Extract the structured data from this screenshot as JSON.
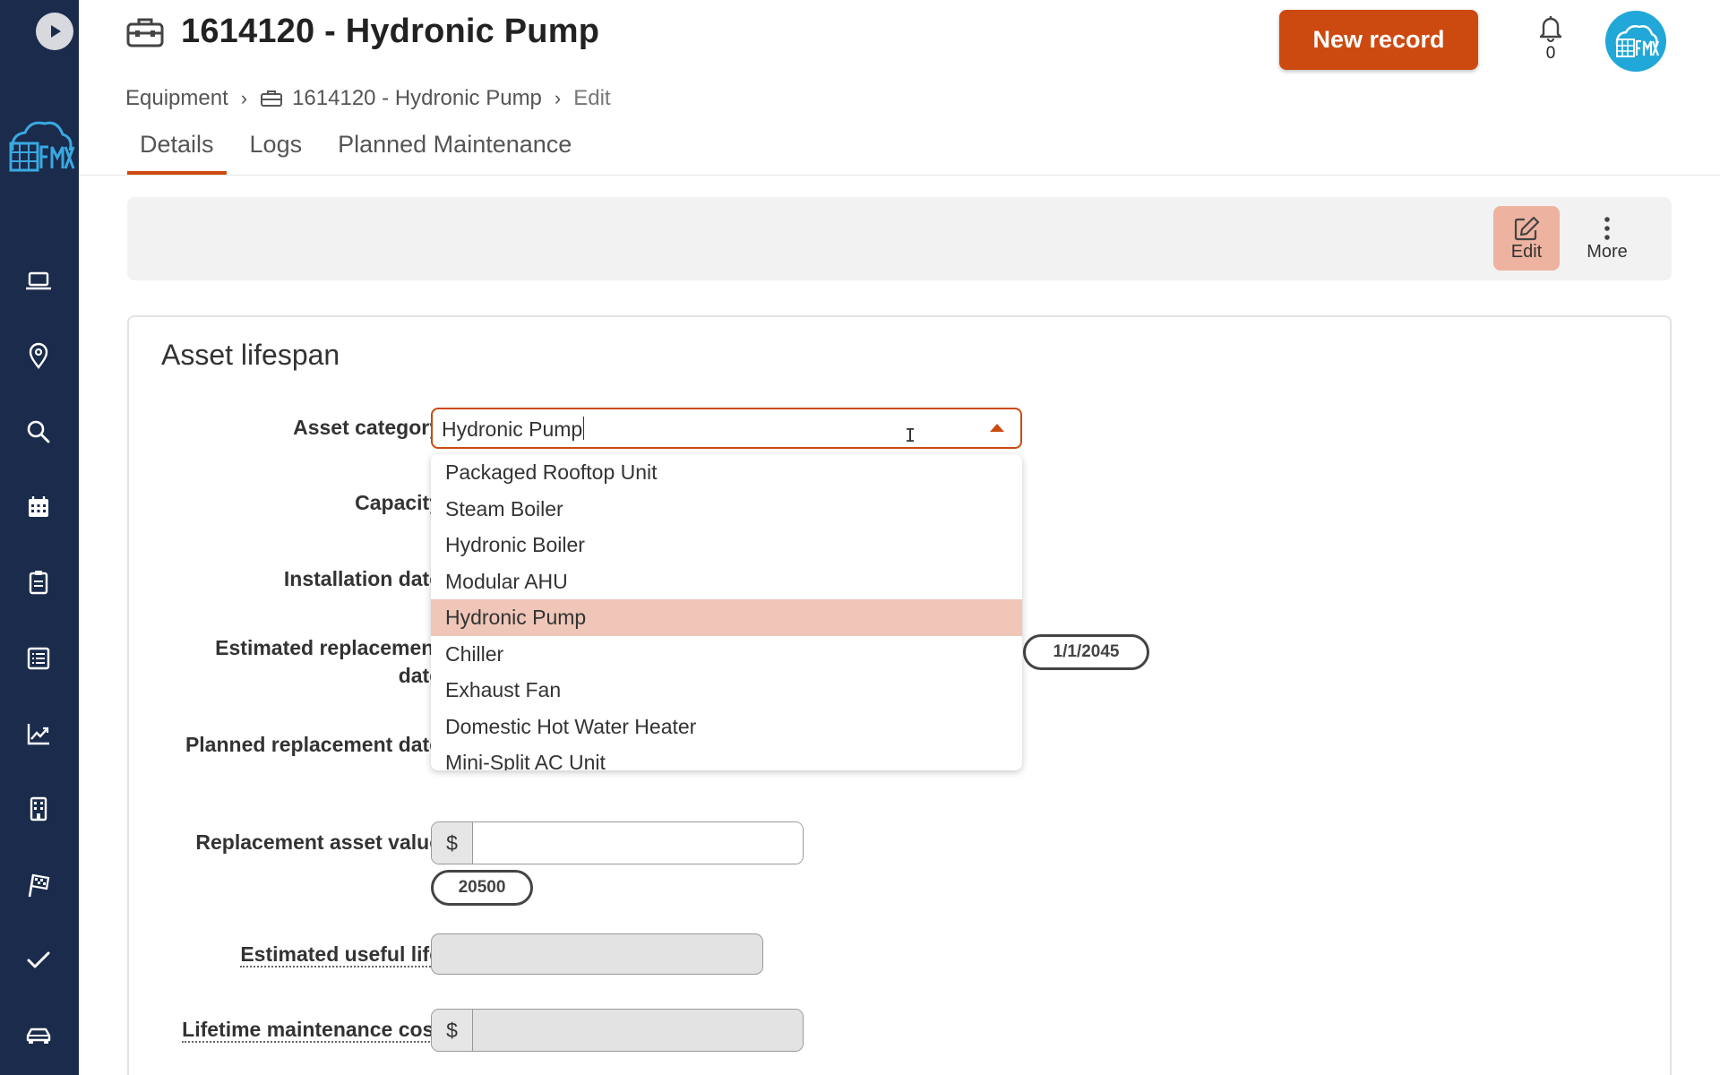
{
  "header": {
    "title": "1614120 - Hydronic Pump",
    "new_record_label": "New record",
    "notification_count": "0"
  },
  "breadcrumb": {
    "items": [
      "Equipment",
      "1614120 - Hydronic Pump",
      "Edit"
    ]
  },
  "tabs": [
    "Details",
    "Logs",
    "Planned Maintenance"
  ],
  "toolbar": {
    "edit_label": "Edit",
    "more_label": "More"
  },
  "section": {
    "title": "Asset lifespan",
    "fields": {
      "asset_category": "Asset category",
      "capacity": "Capacity",
      "installation_date": "Installation date",
      "estimated_replacement_date": "Estimated replacement date",
      "planned_replacement_date": "Planned replacement date",
      "replacement_asset_value": "Replacement asset value",
      "estimated_useful_life": "Estimated useful life",
      "lifetime_maintenance_cost": "Lifetime maintenance cost"
    },
    "asset_category_value": "Hydronic Pump",
    "estimated_replacement_suggestion": "1/1/2045",
    "replacement_value_suggestion": "20500",
    "currency_symbol": "$"
  },
  "dropdown_options": [
    "Packaged Rooftop Unit",
    "Steam Boiler",
    "Hydronic Boiler",
    "Modular AHU",
    "Hydronic Pump",
    "Chiller",
    "Exhaust Fan",
    "Domestic Hot Water Heater",
    "Mini-Split AC Unit"
  ],
  "selected_option": "Hydronic Pump",
  "colors": {
    "sidebar_bg": "#1a2b4c",
    "accent": "#cc4a10",
    "selected_option_bg": "#efc6b8",
    "avatar_bg": "#21a7d8"
  },
  "sidebar_icons": [
    "play-icon",
    "laptop-icon",
    "location-pin-icon",
    "search-icon",
    "calendar-icon",
    "clipboard-icon",
    "list-icon",
    "chart-icon",
    "building-icon",
    "flag-icon",
    "check-icon",
    "car-icon"
  ]
}
